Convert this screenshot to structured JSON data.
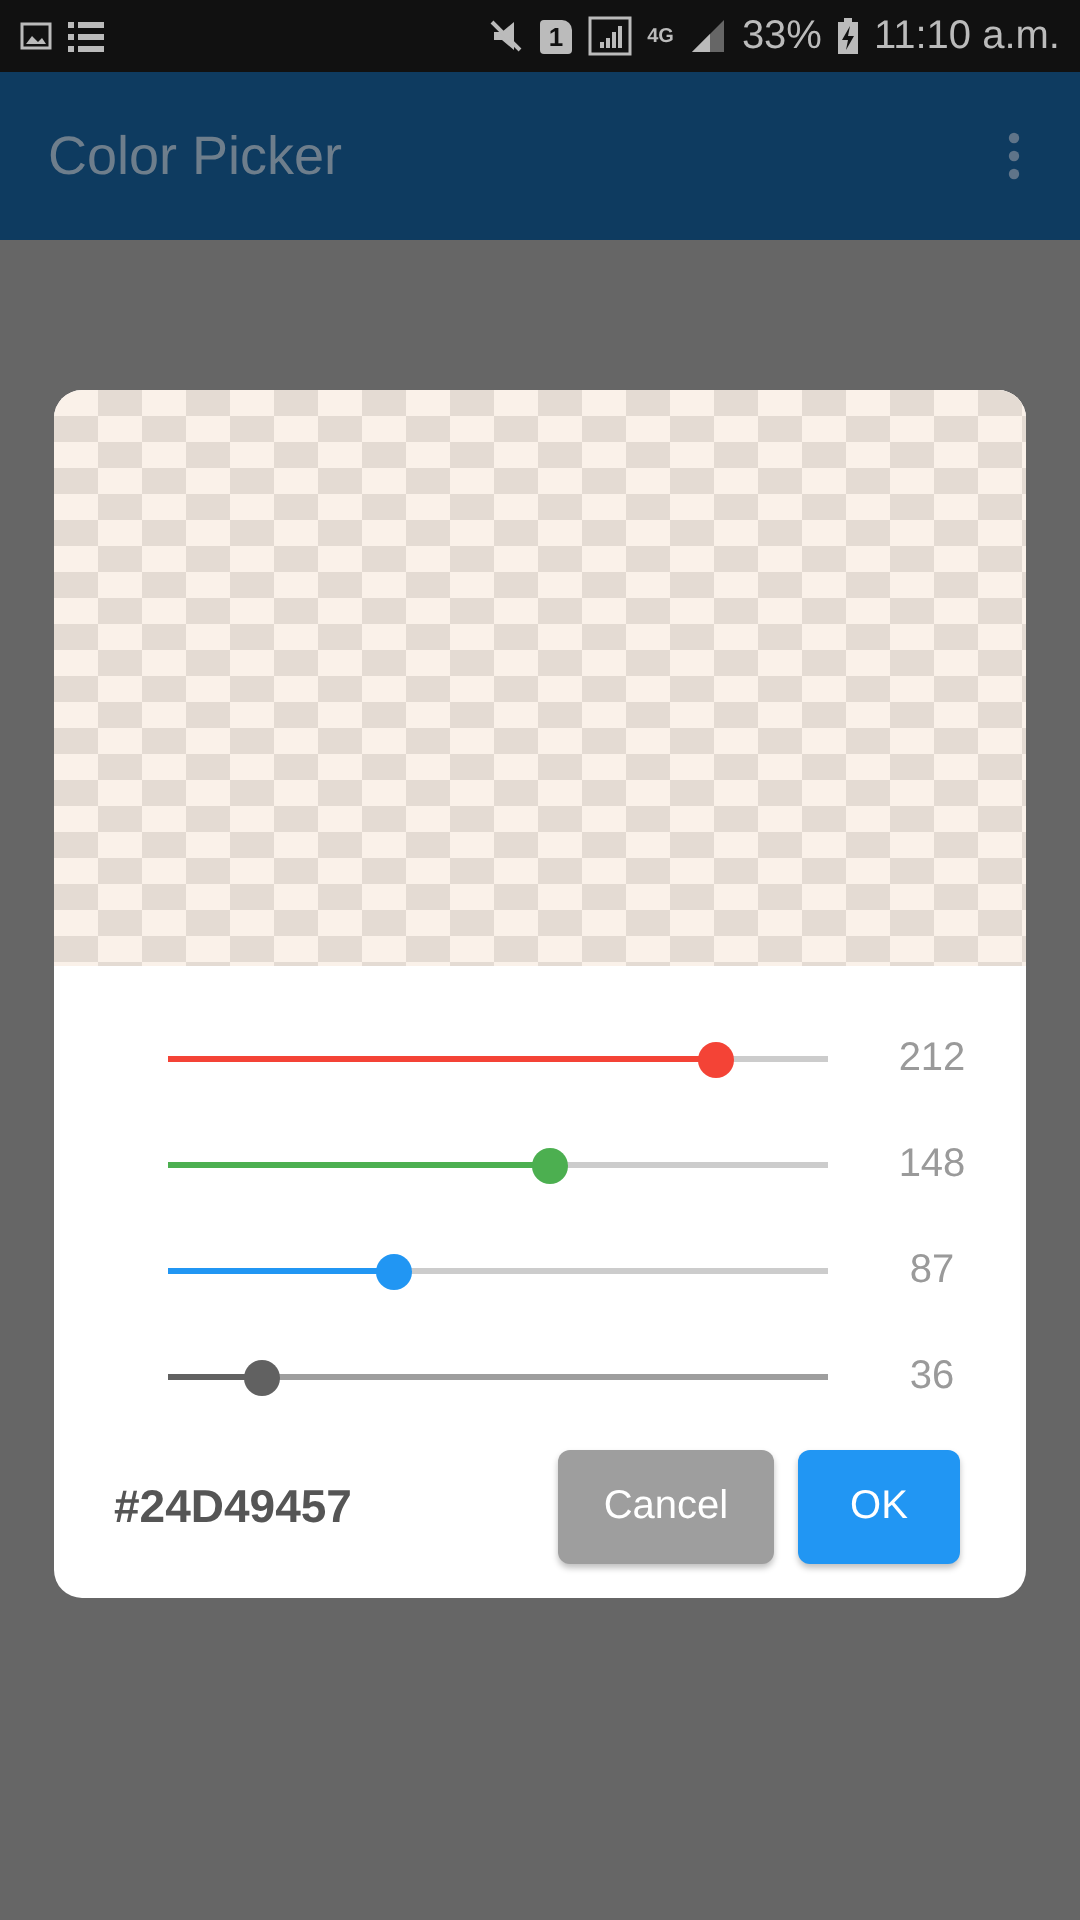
{
  "status_bar": {
    "sim_label": "1",
    "network": "4G",
    "battery": "33%",
    "time": "11:10 a.m."
  },
  "app_bar": {
    "title": "Color Picker"
  },
  "dialog": {
    "sliders": [
      {
        "kind": "channel",
        "color": "#f44336",
        "level": 0.831,
        "reading": "212"
      },
      {
        "kind": "channel",
        "color": "#4caf50",
        "level": 0.58,
        "reading": "148"
      },
      {
        "kind": "channel",
        "color": "#2196f3",
        "level": 0.341,
        "reading": "87"
      },
      {
        "kind": "alpha",
        "color": "#616161",
        "level": 0.141,
        "reading": "36"
      }
    ],
    "hex": "#24D49457",
    "buttons": [
      {
        "kind": "secondary",
        "label": "Cancel"
      },
      {
        "kind": "primary",
        "label": "OK"
      }
    ]
  }
}
